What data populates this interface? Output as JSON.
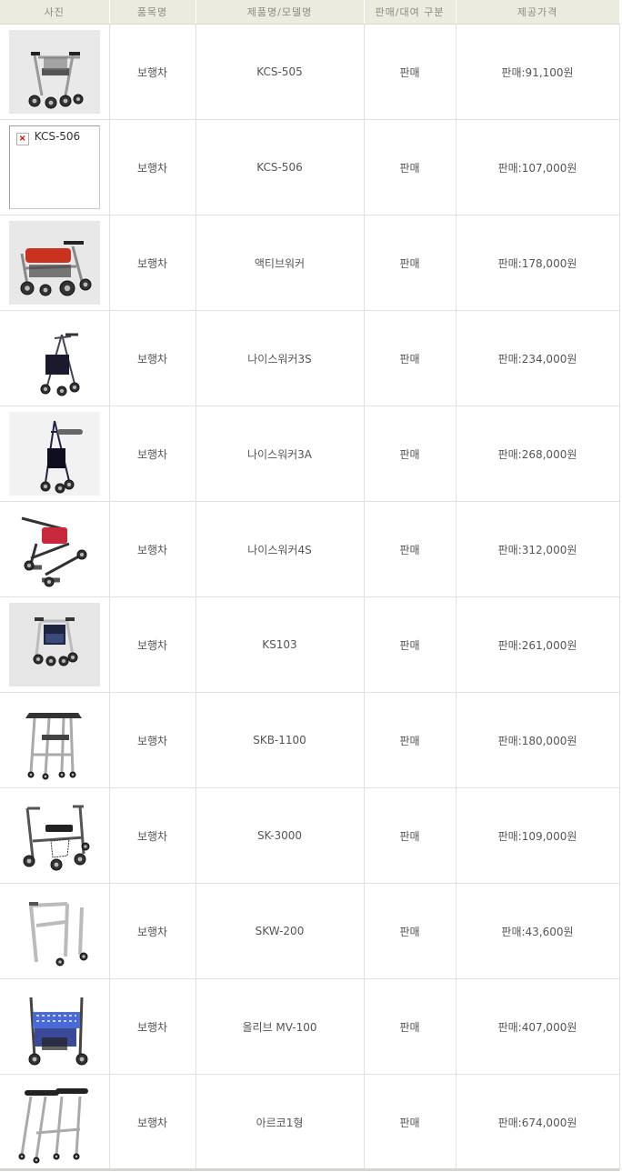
{
  "headers": [
    "사진",
    "품목명",
    "제품명/모델명",
    "판매/대여 구분",
    "제공가격"
  ],
  "rows": [
    {
      "category": "보행차",
      "model": "KCS-505",
      "type": "판매",
      "price": "판매:91,100원",
      "image": "walker-seat"
    },
    {
      "category": "보행차",
      "model": "KCS-506",
      "type": "판매",
      "price": "판매:107,000원",
      "image": "broken",
      "image_alt": "KCS-506"
    },
    {
      "category": "보행차",
      "model": "액티브워커",
      "type": "판매",
      "price": "판매:178,000원",
      "image": "walker-red"
    },
    {
      "category": "보행차",
      "model": "나이스워커3S",
      "type": "판매",
      "price": "판매:234,000원",
      "image": "walker-3wheel"
    },
    {
      "category": "보행차",
      "model": "나이스워커3A",
      "type": "판매",
      "price": "판매:268,000원",
      "image": "walker-3wheel-tall"
    },
    {
      "category": "보행차",
      "model": "나이스워커4S",
      "type": "판매",
      "price": "판매:312,000원",
      "image": "walker-pink"
    },
    {
      "category": "보행차",
      "model": "KS103",
      "type": "판매",
      "price": "판매:261,000원",
      "image": "walker-bag"
    },
    {
      "category": "보행차",
      "model": "SKB-1100",
      "type": "판매",
      "price": "판매:180,000원",
      "image": "walker-frame-armrest"
    },
    {
      "category": "보행차",
      "model": "SK-3000",
      "type": "판매",
      "price": "판매:109,000원",
      "image": "walker-rollator"
    },
    {
      "category": "보행차",
      "model": "SKW-200",
      "type": "판매",
      "price": "판매:43,600원",
      "image": "walker-folding"
    },
    {
      "category": "보행차",
      "model": "올리브 MV-100",
      "type": "판매",
      "price": "판매:407,000원",
      "image": "walker-blue-pattern"
    },
    {
      "category": "보행차",
      "model": "아르코1형",
      "type": "판매",
      "price": "판매:674,000원",
      "image": "walker-arco"
    }
  ]
}
